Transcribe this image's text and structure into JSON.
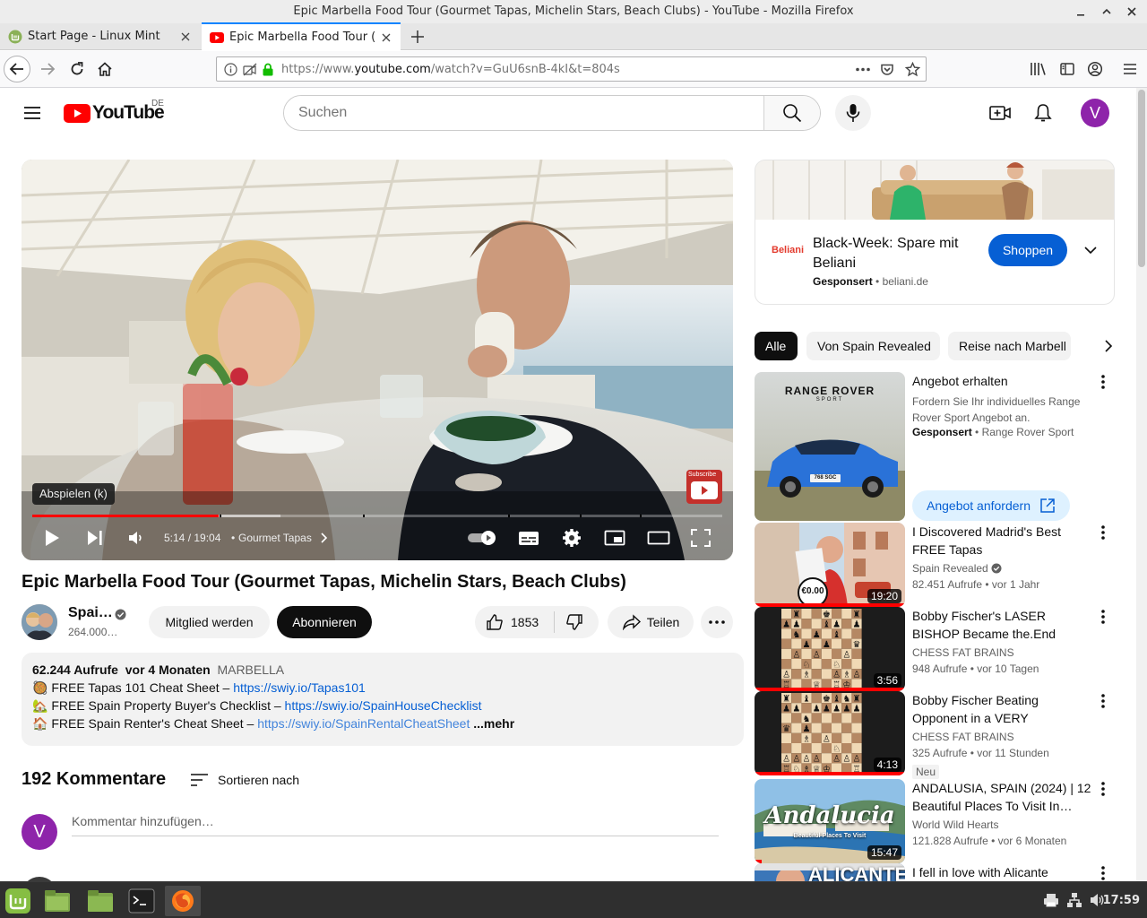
{
  "window": {
    "title": "Epic Marbella Food Tour (Gourmet Tapas, Michelin Stars, Beach Clubs) - YouTube - Mozilla Firefox"
  },
  "tabs": [
    {
      "label": "Start Page - Linux Mint",
      "active": false
    },
    {
      "label": "Epic Marbella Food Tour (G",
      "active": true
    }
  ],
  "nav": {
    "url_prefix": "https://www.",
    "url_domain": "youtube.com",
    "url_path": "/watch?v=GuU6snB-4kI&t=804s"
  },
  "masthead": {
    "logo_text": "YouTube",
    "region": "DE",
    "search_placeholder": "Suchen",
    "avatar_letter": "V"
  },
  "player": {
    "tooltip": "Abspielen (k)",
    "time": "5:14 / 19:04",
    "chapter": "Gourmet Tapas",
    "progress_played": 0.27,
    "progress_buffered": 0.36,
    "subscribe_watermark": "Subscribe"
  },
  "video": {
    "title": "Epic Marbella Food Tour (Gourmet Tapas, Michelin Stars, Beach Clubs)",
    "channel": "Spai…",
    "subscribers": "264.000…",
    "member_button": "Mitglied werden",
    "subscribe_button": "Abonnieren",
    "likes": "1853",
    "share": "Teilen",
    "views": "62.244 Aufrufe",
    "age": "vor 4 Monaten",
    "hashtag": "MARBELLA",
    "desc_lines": [
      {
        "emoji": "🥘",
        "text": "FREE Tapas 101 Cheat Sheet – ",
        "link": "https://swiy.io/Tapas101"
      },
      {
        "emoji": "🏡",
        "text": "FREE Spain Property Buyer's Checklist – ",
        "link": "https://swiy.io/SpainHouseChecklist"
      },
      {
        "emoji": "🏠",
        "text": "FREE Spain Renter's Cheat Sheet – ",
        "link": "https://swiy.io/SpainRentalCheatSheet"
      }
    ],
    "more": "...mehr"
  },
  "comments": {
    "count": "192 Kommentare",
    "sort": "Sortieren nach",
    "placeholder": "Kommentar hinzufügen…",
    "avatar": "V"
  },
  "ad": {
    "brand_logo": "Beliani",
    "title": "Black-Week: Spare mit Beliani",
    "sponsored": "Gesponsert",
    "domain": "beliani.de",
    "cta": "Shoppen"
  },
  "chips": [
    "Alle",
    "Von Spain Revealed",
    "Reise nach Marbell"
  ],
  "range_rover_ad": {
    "title": "Angebot erhalten",
    "body": "Fordern Sie Ihr individuelles Range Rover Sport Angebot an.",
    "sponsored": "Gesponsert",
    "advertiser": "Range Rover Sport",
    "cta": "Angebot anfordern",
    "thumb_brand": "RANGE ROVER",
    "thumb_sub": "SPORT",
    "plate": "768 SGC"
  },
  "recommendations": [
    {
      "title": "I Discovered Madrid's Best FREE Tapas",
      "channel": "Spain Revealed",
      "verified": true,
      "meta": "82.451 Aufrufe • vor 1 Jahr",
      "duration": "19:20",
      "price": "€0.00"
    },
    {
      "title": "Bobby Fischer's LASER BISHOP Became the.End Game…",
      "channel": "CHESS FAT BRAINS",
      "meta": "948 Aufrufe • vor 10 Tagen",
      "duration": "3:56"
    },
    {
      "title": "Bobby Fischer Beating Opponent in a VERY ANNOYIN…",
      "channel": "CHESS FAT BRAINS",
      "meta": "325 Aufrufe • vor 11 Stunden",
      "badge": "Neu",
      "duration": "4:13"
    },
    {
      "title": "ANDALUSIA, SPAIN (2024) | 12 Beautiful Places To Visit In…",
      "channel": "World Wild Hearts",
      "meta": "121.828 Aufrufe • vor 6 Monaten",
      "duration": "15:47",
      "thumb_text": "Andalucia",
      "thumb_sub": "Beautiful Places To Visit"
    },
    {
      "title": "I fell in love with Alicante",
      "thumb_text": "ALICANTE"
    }
  ],
  "taskbar": {
    "clock": "17:59"
  }
}
